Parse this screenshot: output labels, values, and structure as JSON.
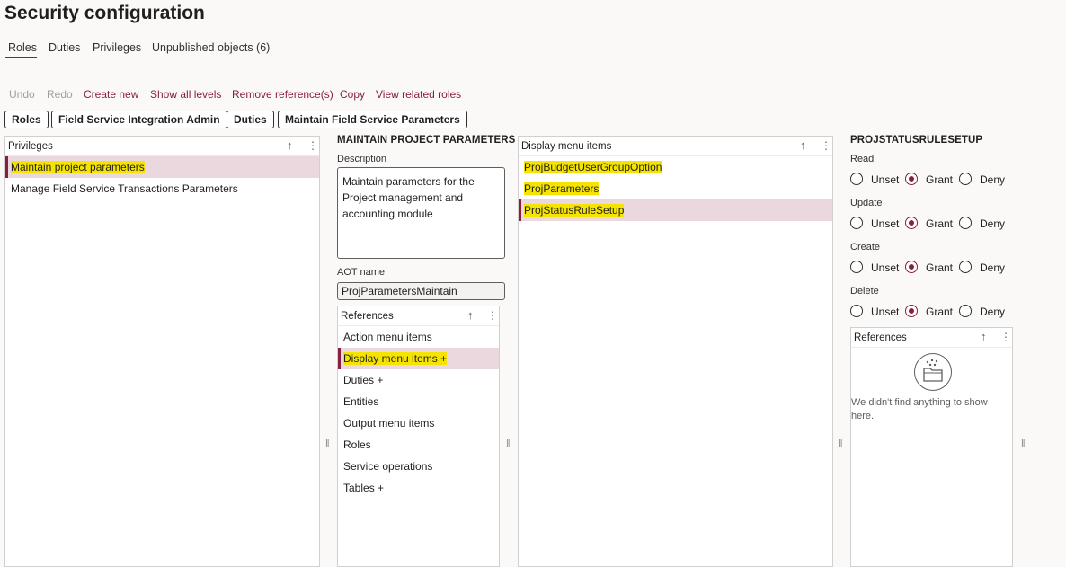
{
  "page": {
    "title": "Security configuration"
  },
  "tabs": [
    {
      "label": "Roles",
      "selected": true
    },
    {
      "label": "Duties"
    },
    {
      "label": "Privileges"
    },
    {
      "label": "Unpublished objects (6)"
    }
  ],
  "actions": {
    "undo": "Undo",
    "redo": "Redo",
    "create_new": "Create new",
    "show_all_levels": "Show all levels",
    "remove_references": "Remove reference(s)",
    "copy": "Copy",
    "view_related_roles": "View related roles"
  },
  "breadcrumbs": [
    "Roles",
    "Field Service Integration Admin",
    "Duties",
    "Maintain Field Service Parameters"
  ],
  "privileges_pane": {
    "header": "Privileges",
    "items": [
      "Maintain project parameters",
      "Manage Field Service Transactions Parameters"
    ]
  },
  "details": {
    "title": "MAINTAIN PROJECT PARAMETERS",
    "description_label": "Description",
    "description_value": "Maintain parameters for the Project management and accounting module",
    "aot_label": "AOT name",
    "aot_value": "ProjParametersMaintain",
    "references_header": "References",
    "references": [
      "Action menu items",
      "Display menu items +",
      "Duties +",
      "Entities",
      "Output menu items",
      "Roles",
      "Service operations",
      "Tables +"
    ]
  },
  "display_menu_pane": {
    "header": "Display menu items",
    "items": [
      "ProjBudgetUserGroupOption",
      "ProjParameters",
      "ProjStatusRuleSetup"
    ]
  },
  "permissions": {
    "title": "PROJSTATUSRULESETUP",
    "options": {
      "unset": "Unset",
      "grant": "Grant",
      "deny": "Deny"
    },
    "groups": [
      {
        "label": "Read",
        "value": "Grant"
      },
      {
        "label": "Update",
        "value": "Grant"
      },
      {
        "label": "Create",
        "value": "Grant"
      },
      {
        "label": "Delete",
        "value": "Grant"
      }
    ],
    "references_header": "References",
    "empty_message": "We didn't find anything to show here."
  },
  "icons": {
    "sort": "arrow-up-icon",
    "more": "more-vertical-icon",
    "splitter": "splitter-handle-icon",
    "empty": "empty-folder-icon"
  },
  "colors": {
    "accent": "#8a1f3d",
    "selected_row": "#ead8de",
    "highlight": "#f5e400"
  }
}
